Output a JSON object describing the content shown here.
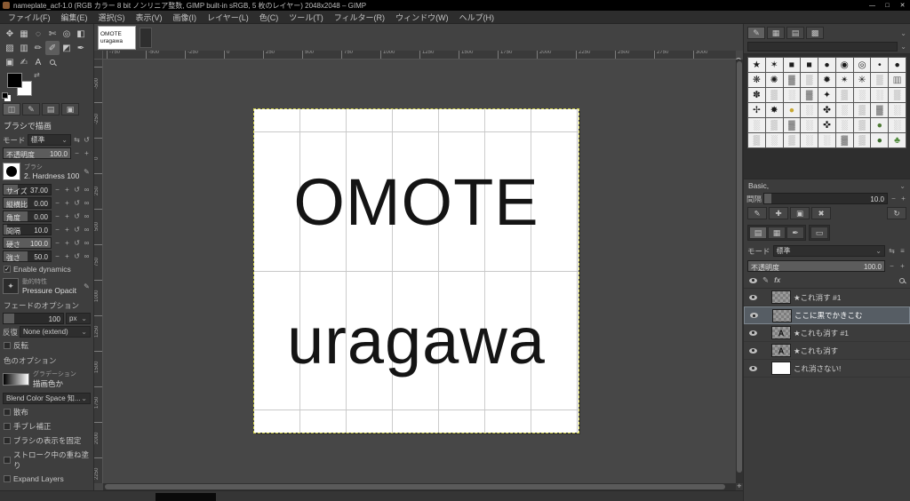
{
  "window": {
    "title": "nameplate_acf-1.0 (RGB カラー 8 bit ノンリニア整数, GIMP built-in sRGB, 5 枚のレイヤー) 2048x2048 – GIMP"
  },
  "icons": {
    "window_min": "—",
    "window_max": "□",
    "window_close": "✕",
    "chevron_down": "⌄",
    "minus": "−",
    "plus": "+",
    "reset": "↺",
    "link": "∞",
    "check": "✓",
    "edit": "✎",
    "new": "✚",
    "duplicate": "▣",
    "delete": "✖",
    "refresh": "↻",
    "swap": "⇄",
    "nav": "✛",
    "mode_switch": "⇆",
    "menu": "≡",
    "fx": "fx"
  },
  "menu_bar": {
    "items": [
      "ファイル(F)",
      "編集(E)",
      "選択(S)",
      "表示(V)",
      "画像(I)",
      "レイヤー(L)",
      "色(C)",
      "ツール(T)",
      "フィルター(R)",
      "ウィンドウ(W)",
      "ヘルプ(H)"
    ]
  },
  "toolbox": {
    "tools": [
      {
        "id": "move",
        "glyph": "✥"
      },
      {
        "id": "rect-select",
        "glyph": "▦"
      },
      {
        "id": "free-select",
        "glyph": "◌"
      },
      {
        "id": "scissors-select",
        "glyph": "✄"
      },
      {
        "id": "fuzzy-select",
        "glyph": "◎"
      },
      {
        "id": "crop",
        "glyph": "◧"
      },
      {
        "id": "bucket-fill",
        "glyph": "▨"
      },
      {
        "id": "gradient",
        "glyph": "▥"
      },
      {
        "id": "pencil",
        "glyph": "✏"
      },
      {
        "id": "paintbrush",
        "glyph": "✐",
        "active": true
      },
      {
        "id": "eraser",
        "glyph": "◩"
      },
      {
        "id": "ink",
        "glyph": "✒"
      },
      {
        "id": "clone",
        "glyph": "▣"
      },
      {
        "id": "airbrush",
        "glyph": "✍"
      },
      {
        "id": "text",
        "glyph": "A"
      },
      {
        "id": "zoom",
        "kind": "mag"
      }
    ]
  },
  "tool_options": {
    "dock_icons": [
      "◫",
      "✎",
      "▤",
      "▣"
    ],
    "title": "ブラシで描画",
    "mode_label": "モード",
    "mode_value": "標準",
    "opacity_label": "不透明度",
    "opacity_value": "100.0",
    "brush_label": "ブラシ",
    "brush_name": "2. Hardness 100",
    "sliders": [
      {
        "id": "size",
        "label": "サイズ",
        "value": "37.00",
        "fill": 30
      },
      {
        "id": "aspect-ratio",
        "label": "縦横比",
        "value": "0.00",
        "fill": 50
      },
      {
        "id": "angle",
        "label": "角度",
        "value": "0.00",
        "fill": 50
      },
      {
        "id": "spacing",
        "label": "間隔",
        "value": "10.0",
        "fill": 8
      },
      {
        "id": "hardness",
        "label": "硬さ",
        "value": "100.0",
        "fill": 100
      },
      {
        "id": "force",
        "label": "強さ",
        "value": "50.0",
        "fill": 50
      }
    ],
    "dynamics_check": "Enable dynamics",
    "dynamics_label": "動的特性",
    "dynamics_value": "Pressure Opacit",
    "fade_section": "フェードのオプション",
    "fade_value": "100",
    "fade_unit": "px",
    "repeat_label": "反復",
    "repeat_value": "None (extend)",
    "reverse_label": "反転",
    "color_section": "色のオプション",
    "gradient_label": "グラデーション",
    "gradient_value": "描画色か",
    "blend_label": "Blend Color Space 知...",
    "checkboxes": [
      "散布",
      "手ブレ補正",
      "ブラシの表示を固定",
      "ストローク中の重ね塗り",
      "Expand Layers"
    ]
  },
  "canvas": {
    "tab_line1": "OMOTE",
    "tab_line2": "uragawa",
    "image_text_top": "OMOTE",
    "image_text_bottom": "uragawa"
  },
  "rulers": {
    "horizontal": [
      "-750",
      "-500",
      "-250",
      "0",
      "250",
      "500",
      "750",
      "1000",
      "1250",
      "1500",
      "1750",
      "2000",
      "2250",
      "2500",
      "2750",
      "3000"
    ],
    "vertical": [
      "-500",
      "-250",
      "0",
      "250",
      "500",
      "750",
      "1000",
      "1250",
      "1500",
      "1750",
      "2000",
      "2250"
    ]
  },
  "brushes_panel": {
    "dock_icons": [
      "✎",
      "▦",
      "▤",
      "▩"
    ],
    "group_label": "Basic,",
    "spacing_label": "間隔",
    "spacing_value": "10.0",
    "cells": [
      {
        "g": "★"
      },
      {
        "g": "✶"
      },
      {
        "g": "■"
      },
      {
        "g": "■"
      },
      {
        "g": "●"
      },
      {
        "g": "◉"
      },
      {
        "g": "◎"
      },
      {
        "g": "•"
      },
      {
        "g": "●"
      },
      {
        "g": "❋"
      },
      {
        "g": "✺"
      },
      {
        "g": "▓",
        "c": "#777777"
      },
      {
        "g": "▒",
        "c": "#888888"
      },
      {
        "g": "✹"
      },
      {
        "g": "✴"
      },
      {
        "g": "✳"
      },
      {
        "g": "▒",
        "c": "#888888"
      },
      {
        "g": "▥",
        "c": "#666666"
      },
      {
        "g": "✽"
      },
      {
        "g": "▒",
        "c": "#888888"
      },
      {
        "g": "░",
        "c": "#999999"
      },
      {
        "g": "▓",
        "c": "#777777"
      },
      {
        "g": "✦"
      },
      {
        "g": "▒",
        "c": "#888888"
      },
      {
        "g": "░",
        "c": "#999999"
      },
      {
        "g": "░",
        "c": "#999999"
      },
      {
        "g": "▒",
        "c": "#888888"
      },
      {
        "g": "✢"
      },
      {
        "g": "✸"
      },
      {
        "g": "●",
        "c": "#c8a832"
      },
      {
        "g": "░",
        "c": "#999999"
      },
      {
        "g": "✤"
      },
      {
        "g": "░",
        "c": "#999999"
      },
      {
        "g": "▒",
        "c": "#888888"
      },
      {
        "g": "▓",
        "c": "#777777"
      },
      {
        "g": "░",
        "c": "#999999"
      },
      {
        "g": "░",
        "c": "#999999"
      },
      {
        "g": "▒",
        "c": "#888888"
      },
      {
        "g": "▓",
        "c": "#777777"
      },
      {
        "g": "░",
        "c": "#999999"
      },
      {
        "g": "✜"
      },
      {
        "g": "░",
        "c": "#999999"
      },
      {
        "g": "▒",
        "c": "#888888"
      },
      {
        "g": "●",
        "c": "#4e7a34"
      },
      {
        "g": "░",
        "c": "#999999"
      },
      {
        "g": "▒",
        "c": "#888888"
      },
      {
        "g": "░",
        "c": "#999999"
      },
      {
        "g": "▒",
        "c": "#888888"
      },
      {
        "g": "░",
        "c": "#999999"
      },
      {
        "g": "░",
        "c": "#999999"
      },
      {
        "g": "▓",
        "c": "#777777"
      },
      {
        "g": "▒",
        "c": "#888888"
      },
      {
        "g": "●",
        "c": "#3a6b2a"
      },
      {
        "g": "♣",
        "c": "#4e8a3a"
      }
    ]
  },
  "layers_panel": {
    "dock_icons": [
      "▤",
      "▦",
      "✒"
    ],
    "extra_tab_icon": "▭",
    "mode_label": "モード",
    "mode_value": "標準",
    "opacity_label": "不透明度",
    "opacity_value": "100.0",
    "items": [
      {
        "name": "★これ消す #1",
        "thumb": "checker"
      },
      {
        "name": "ここに黒でかきこむ",
        "thumb": "checker",
        "selected": true
      },
      {
        "name": "★これも消す #1",
        "thumb": "text"
      },
      {
        "name": "★これも消す",
        "thumb": "text"
      },
      {
        "name": "これ消さない!",
        "thumb": "white"
      }
    ]
  }
}
